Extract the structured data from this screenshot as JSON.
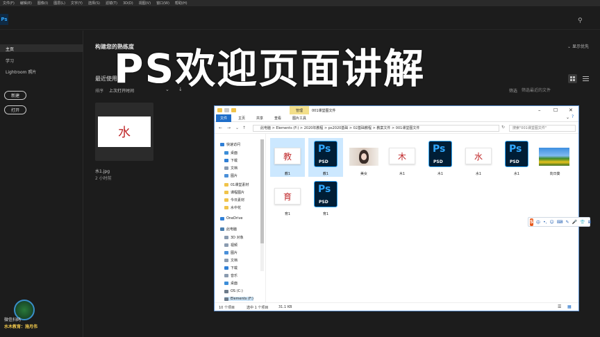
{
  "menubar": [
    "文件(F)",
    "编辑(E)",
    "图像(I)",
    "图层(L)",
    "文字(Y)",
    "选择(S)",
    "滤镜(T)",
    "3D(D)",
    "视图(V)",
    "窗口(W)",
    "帮助(H)"
  ],
  "app": {
    "logo": "Ps"
  },
  "overlay_title": "PS欢迎页面讲解",
  "left_panel": {
    "nav": [
      "主页",
      "学习",
      "Lightroom 照片"
    ],
    "new_button": "新建",
    "open_button": "打开",
    "brand_line1": "微信扫码",
    "brand_line2": "水木教育：施月伟"
  },
  "main": {
    "section_title": "构建您的熟练度",
    "collapse": "显示优先",
    "recent_title": "最近使用项",
    "sort_label": "排序",
    "sort_value": "上次打开时间",
    "filter_label": "筛选",
    "filter_placeholder": "筛选最近的文件",
    "recent_file": {
      "char": "水",
      "name": "水1.jpg",
      "time": "2 小时前"
    }
  },
  "explorer": {
    "ctx_tab": "管理",
    "title": "001课堂图文件",
    "ribbon_tabs": [
      "文件",
      "主页",
      "共享",
      "查看",
      "图片工具"
    ],
    "address": "此电脑 > Elements (F:) > 2020年教程 > ps2020基础 > 02基础教程 > 教案文件 > 001课堂图文件",
    "search_placeholder": "搜索\"001课堂图文件\"",
    "nav_items": [
      {
        "label": "快速访问",
        "type": "star"
      },
      {
        "label": "桌面",
        "type": "desk"
      },
      {
        "label": "下载",
        "type": "down"
      },
      {
        "label": "文档",
        "type": "doc"
      },
      {
        "label": "图片",
        "type": "pic"
      },
      {
        "label": "01课堂素材",
        "type": "folder"
      },
      {
        "label": "课程图片",
        "type": "folder"
      },
      {
        "label": "今日素材",
        "type": "folder"
      },
      {
        "label": "水中花",
        "type": "folder"
      },
      {
        "label": "OneDrive",
        "type": "cloud"
      },
      {
        "label": "此电脑",
        "type": "pc"
      },
      {
        "label": "3D 对象",
        "type": "doc"
      },
      {
        "label": "视频",
        "type": "doc"
      },
      {
        "label": "图片",
        "type": "pic"
      },
      {
        "label": "文档",
        "type": "doc"
      },
      {
        "label": "下载",
        "type": "down"
      },
      {
        "label": "音乐",
        "type": "doc"
      },
      {
        "label": "桌面",
        "type": "desk"
      },
      {
        "label": "OS (C:)",
        "type": "drive"
      },
      {
        "label": "Elements (F:)",
        "type": "drive"
      }
    ],
    "files": [
      {
        "name": "教1",
        "kind": "img",
        "char": "教",
        "selected": true
      },
      {
        "name": "教1",
        "kind": "psd",
        "selected": true
      },
      {
        "name": "美女",
        "kind": "photo",
        "selected": false
      },
      {
        "name": "木1",
        "kind": "img",
        "char": "木",
        "selected": false
      },
      {
        "name": "木1",
        "kind": "psd",
        "selected": false
      },
      {
        "name": "水1",
        "kind": "img",
        "char": "水",
        "selected": false
      },
      {
        "name": "水1",
        "kind": "psd",
        "selected": false
      },
      {
        "name": "向日葵",
        "kind": "sunflower",
        "selected": false
      },
      {
        "name": "育1",
        "kind": "img",
        "char": "育",
        "selected": false
      },
      {
        "name": "育1",
        "kind": "psd",
        "selected": false
      }
    ],
    "status": {
      "count": "10 个项目",
      "selection": "选中 1 个项目",
      "size": "31.1 KB"
    }
  },
  "ime": {
    "logo": "S",
    "mode": "中",
    "items": [
      "•,",
      "☺",
      "⌨",
      "✎",
      "🎤",
      "👕",
      "⊞"
    ]
  }
}
